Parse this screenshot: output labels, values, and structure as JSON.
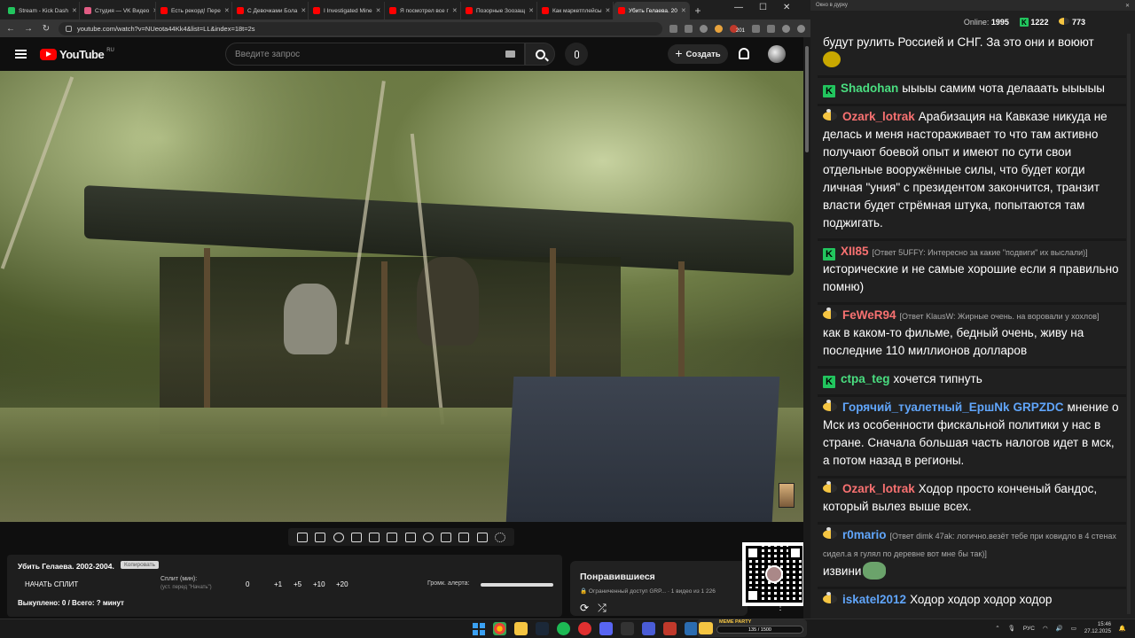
{
  "browser": {
    "tabs": [
      {
        "label": "Stream - Kick Dash",
        "color": "#22c55e",
        "active": false
      },
      {
        "label": "Студия — VK Видео",
        "color": "#e25c84",
        "active": false
      },
      {
        "label": "Есть рекорд! Пере",
        "color": "#ff0000",
        "active": false
      },
      {
        "label": "С Девочками Бола",
        "color": "#ff0000",
        "active": false
      },
      {
        "label": "I Investigated Mine",
        "color": "#ff0000",
        "active": false
      },
      {
        "label": "Я посмотрел все г",
        "color": "#ff0000",
        "active": false
      },
      {
        "label": "Позорные Зоозащ",
        "color": "#ff0000",
        "active": false
      },
      {
        "label": "Как маркетплейсы",
        "color": "#ff0000",
        "active": false
      },
      {
        "label": "Убить Гелаева. 20",
        "color": "#ff0000",
        "active": true
      }
    ],
    "url": "youtube.com/watch?v=NUeota44Kk4&list=LL&index=18t=2s",
    "new_tab": "+",
    "win_min": "—",
    "win_max": "☐",
    "win_close": "✕",
    "back": "←",
    "forward": "→",
    "reload": "↻",
    "extension_badge": "201"
  },
  "youtube": {
    "logo_text": "YouTube",
    "logo_region": "RU",
    "search_placeholder": "Введите запрос",
    "create_label": "Создать",
    "create_plus": "+"
  },
  "split_panel": {
    "title": "Убить Гелаева. 2002-2004.",
    "copy_label": "Копировать",
    "start_label": "НАЧАТЬ СПЛИТ",
    "split_label": "Сплит (мин):",
    "split_sub": "(уст. перед \"Начать\")",
    "values": [
      "0",
      "+1",
      "+5",
      "+10",
      "+20"
    ],
    "alert_label": "Громк. алерта:",
    "alert_volume": 1.0,
    "done_text": "Выкуплено: 0 / Всего: ? минут"
  },
  "liked": {
    "title": "Понравившиеся",
    "subtitle": "🔒 Ограниченный доступ GRP... · 1 видео из 1 226",
    "loop": "⟳",
    "shuffle": "⤮",
    "more": "⋮"
  },
  "chat": {
    "window_title": "Окно в дурку",
    "window_close": "✕",
    "online_label": "Online:",
    "online_count": "1995",
    "kick_count": "1222",
    "bee_count": "773",
    "messages": [
      {
        "platform": "bee",
        "nick": "",
        "nick_color": "#ffffff",
        "reply": "",
        "text": "будут рулить Россией и СНГ. За это они и воюют",
        "emote": "face"
      },
      {
        "platform": "kick",
        "nick": "Shadohan",
        "nick_color": "#4ade80",
        "reply": "",
        "text": "ыыыы самим чота делааать ыыыыы",
        "emote": ""
      },
      {
        "platform": "bee",
        "nick": "Ozark_lotrak",
        "nick_color": "#f87171",
        "reply": "",
        "text": "Арабизация на Кавказе никуда не делась и меня настораживает то что там активно получают боевой опыт и имеют по сути свои отдельные вооружённые силы, что будет когди личная \"уния\" с президентом закончится, транзит власти будет стрёмная штука, попытаются там поджигать.",
        "emote": ""
      },
      {
        "platform": "kick",
        "nick": "XII85",
        "nick_color": "#f87171",
        "reply": "[Ответ 5UFFY: Интересно за какие \"подвиги\" их выслали)]",
        "text": "исторические и не самые хорошие если я правильно помню)",
        "emote": ""
      },
      {
        "platform": "bee",
        "nick": "FeWeR94",
        "nick_color": "#f87171",
        "reply": "[Ответ KlausW: Жирные очень. на воровали у хохлов]",
        "text": "как в каком-то фильме, бедный очень, живу на последние 110 миллионов долларов",
        "emote": ""
      },
      {
        "platform": "kick",
        "nick": "ctpa_teg",
        "nick_color": "#4ade80",
        "reply": "",
        "text": "хочется типнуть",
        "emote": ""
      },
      {
        "platform": "bee",
        "nick": "Горячий_туалетный_ЕршNk",
        "nick2": "GRPZDC",
        "nick_color": "#60a5fa",
        "reply": "",
        "text": "мнение о Мск из особенности фискальной политики у нас в стране. Сначала большая часть налогов идет в мск, а потом назад в регионы.",
        "emote": ""
      },
      {
        "platform": "bee",
        "nick": "Ozark_lotrak",
        "nick_color": "#f87171",
        "reply": "",
        "text": "Ходор просто конченый бандос, который вылез выше всех.",
        "emote": ""
      },
      {
        "platform": "bee",
        "nick": "r0mario",
        "nick_color": "#60a5fa",
        "reply": "[Ответ dimk 47ak: логично.везёт тебе при ковидло в 4 стенах сидел.а я гулял по деревне  вот мне бы так)]",
        "text": "извини",
        "emote": "frog"
      },
      {
        "platform": "bee",
        "nick": "iskatel2012",
        "nick_color": "#60a5fa",
        "reply": "",
        "text": "Ходор ходор ходор ходор",
        "emote": ""
      }
    ]
  },
  "taskbar": {
    "meme_label": "MEME PARTY",
    "meme_progress": "135 / 1500",
    "lang": "РУС",
    "time": "15:46",
    "date": "27.12.2025"
  }
}
